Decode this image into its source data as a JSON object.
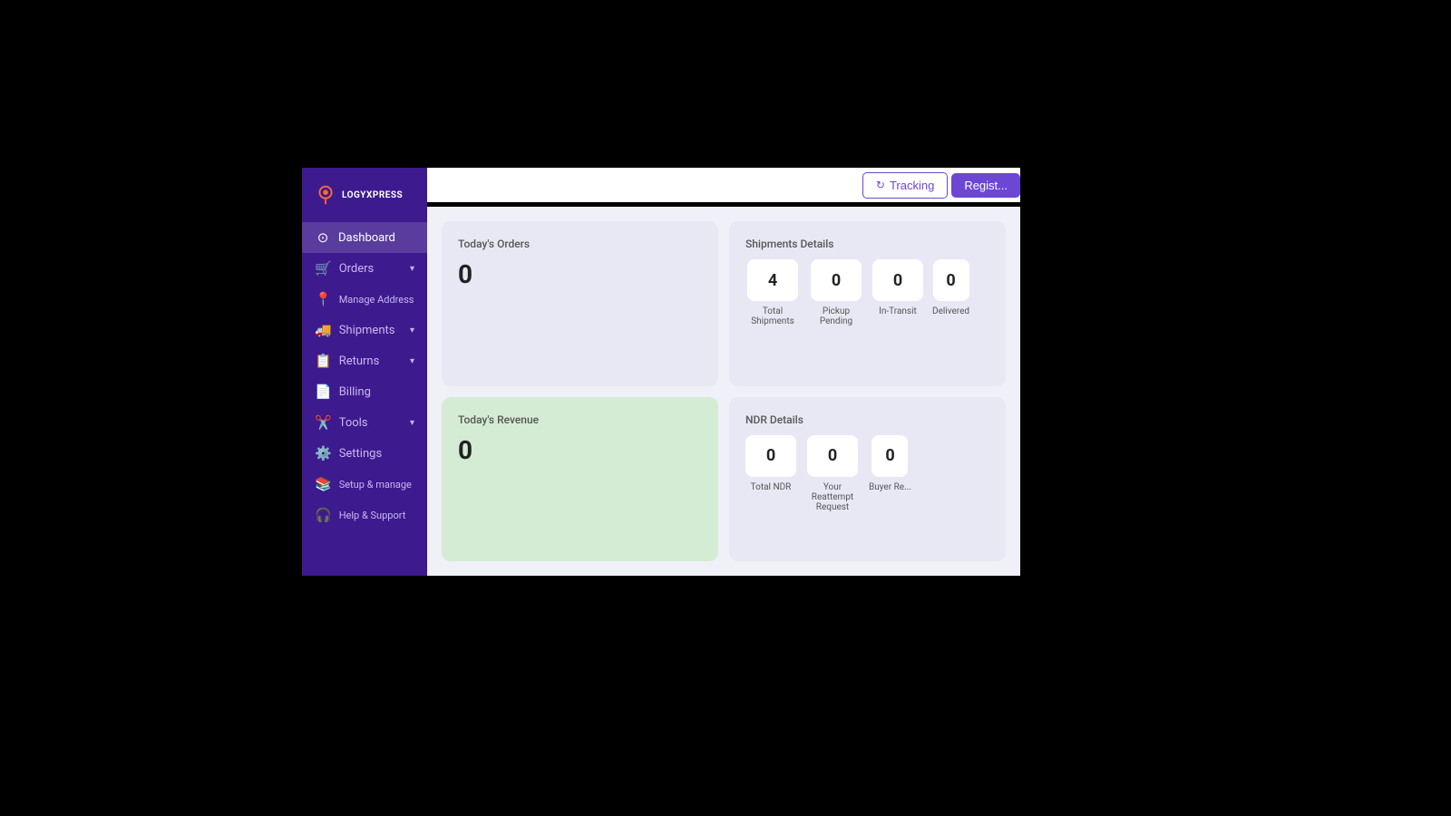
{
  "app": {
    "title": "LogyXpress Dashboard"
  },
  "logo": {
    "text": "LOGYXPRESS"
  },
  "header": {
    "tracking_label": "Tracking",
    "register_label": "Regist..."
  },
  "sidebar": {
    "items": [
      {
        "id": "dashboard",
        "label": "Dashboard",
        "icon": "🏠",
        "active": true,
        "hasChevron": false
      },
      {
        "id": "orders",
        "label": "Orders",
        "icon": "🛒",
        "active": false,
        "hasChevron": true
      },
      {
        "id": "manage-address",
        "label": "Manage Address",
        "icon": "📍",
        "active": false,
        "hasChevron": false
      },
      {
        "id": "shipments",
        "label": "Shipments",
        "icon": "🚚",
        "active": false,
        "hasChevron": true
      },
      {
        "id": "returns",
        "label": "Returns",
        "icon": "📋",
        "active": false,
        "hasChevron": true
      },
      {
        "id": "billing",
        "label": "Billing",
        "icon": "📄",
        "active": false,
        "hasChevron": false
      },
      {
        "id": "tools",
        "label": "Tools",
        "icon": "✂️",
        "active": false,
        "hasChevron": true
      },
      {
        "id": "settings",
        "label": "Settings",
        "icon": "⚙️",
        "active": false,
        "hasChevron": false
      },
      {
        "id": "setup",
        "label": "Setup & manage",
        "icon": "📚",
        "active": false,
        "hasChevron": false
      },
      {
        "id": "help",
        "label": "Help & Support",
        "icon": "🎧",
        "active": false,
        "hasChevron": false
      }
    ]
  },
  "cards": {
    "today_orders": {
      "title": "Today's Orders",
      "value": "0"
    },
    "shipments_details": {
      "title": "Shipments Details",
      "stats": [
        {
          "label": "Total Shipments",
          "value": "4"
        },
        {
          "label": "Pickup Pending",
          "value": "0"
        },
        {
          "label": "In-Transit",
          "value": "0"
        },
        {
          "label": "Delivered",
          "value": "0"
        }
      ]
    },
    "today_revenue": {
      "title": "Today's Revenue",
      "value": "0"
    },
    "ndr_details": {
      "title": "NDR Details",
      "stats": [
        {
          "label": "Total NDR",
          "value": "0"
        },
        {
          "label": "Your Reattempt Request",
          "value": "0"
        },
        {
          "label": "Buyer Re...",
          "value": "0"
        }
      ]
    }
  }
}
